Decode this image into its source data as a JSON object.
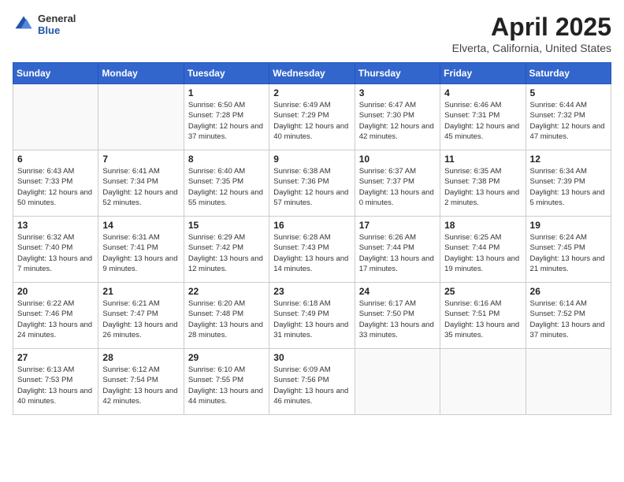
{
  "header": {
    "logo_general": "General",
    "logo_blue": "Blue",
    "title": "April 2025",
    "location": "Elverta, California, United States"
  },
  "weekdays": [
    "Sunday",
    "Monday",
    "Tuesday",
    "Wednesday",
    "Thursday",
    "Friday",
    "Saturday"
  ],
  "weeks": [
    [
      {
        "day": "",
        "info": ""
      },
      {
        "day": "",
        "info": ""
      },
      {
        "day": "1",
        "info": "Sunrise: 6:50 AM\nSunset: 7:28 PM\nDaylight: 12 hours and 37 minutes."
      },
      {
        "day": "2",
        "info": "Sunrise: 6:49 AM\nSunset: 7:29 PM\nDaylight: 12 hours and 40 minutes."
      },
      {
        "day": "3",
        "info": "Sunrise: 6:47 AM\nSunset: 7:30 PM\nDaylight: 12 hours and 42 minutes."
      },
      {
        "day": "4",
        "info": "Sunrise: 6:46 AM\nSunset: 7:31 PM\nDaylight: 12 hours and 45 minutes."
      },
      {
        "day": "5",
        "info": "Sunrise: 6:44 AM\nSunset: 7:32 PM\nDaylight: 12 hours and 47 minutes."
      }
    ],
    [
      {
        "day": "6",
        "info": "Sunrise: 6:43 AM\nSunset: 7:33 PM\nDaylight: 12 hours and 50 minutes."
      },
      {
        "day": "7",
        "info": "Sunrise: 6:41 AM\nSunset: 7:34 PM\nDaylight: 12 hours and 52 minutes."
      },
      {
        "day": "8",
        "info": "Sunrise: 6:40 AM\nSunset: 7:35 PM\nDaylight: 12 hours and 55 minutes."
      },
      {
        "day": "9",
        "info": "Sunrise: 6:38 AM\nSunset: 7:36 PM\nDaylight: 12 hours and 57 minutes."
      },
      {
        "day": "10",
        "info": "Sunrise: 6:37 AM\nSunset: 7:37 PM\nDaylight: 13 hours and 0 minutes."
      },
      {
        "day": "11",
        "info": "Sunrise: 6:35 AM\nSunset: 7:38 PM\nDaylight: 13 hours and 2 minutes."
      },
      {
        "day": "12",
        "info": "Sunrise: 6:34 AM\nSunset: 7:39 PM\nDaylight: 13 hours and 5 minutes."
      }
    ],
    [
      {
        "day": "13",
        "info": "Sunrise: 6:32 AM\nSunset: 7:40 PM\nDaylight: 13 hours and 7 minutes."
      },
      {
        "day": "14",
        "info": "Sunrise: 6:31 AM\nSunset: 7:41 PM\nDaylight: 13 hours and 9 minutes."
      },
      {
        "day": "15",
        "info": "Sunrise: 6:29 AM\nSunset: 7:42 PM\nDaylight: 13 hours and 12 minutes."
      },
      {
        "day": "16",
        "info": "Sunrise: 6:28 AM\nSunset: 7:43 PM\nDaylight: 13 hours and 14 minutes."
      },
      {
        "day": "17",
        "info": "Sunrise: 6:26 AM\nSunset: 7:44 PM\nDaylight: 13 hours and 17 minutes."
      },
      {
        "day": "18",
        "info": "Sunrise: 6:25 AM\nSunset: 7:44 PM\nDaylight: 13 hours and 19 minutes."
      },
      {
        "day": "19",
        "info": "Sunrise: 6:24 AM\nSunset: 7:45 PM\nDaylight: 13 hours and 21 minutes."
      }
    ],
    [
      {
        "day": "20",
        "info": "Sunrise: 6:22 AM\nSunset: 7:46 PM\nDaylight: 13 hours and 24 minutes."
      },
      {
        "day": "21",
        "info": "Sunrise: 6:21 AM\nSunset: 7:47 PM\nDaylight: 13 hours and 26 minutes."
      },
      {
        "day": "22",
        "info": "Sunrise: 6:20 AM\nSunset: 7:48 PM\nDaylight: 13 hours and 28 minutes."
      },
      {
        "day": "23",
        "info": "Sunrise: 6:18 AM\nSunset: 7:49 PM\nDaylight: 13 hours and 31 minutes."
      },
      {
        "day": "24",
        "info": "Sunrise: 6:17 AM\nSunset: 7:50 PM\nDaylight: 13 hours and 33 minutes."
      },
      {
        "day": "25",
        "info": "Sunrise: 6:16 AM\nSunset: 7:51 PM\nDaylight: 13 hours and 35 minutes."
      },
      {
        "day": "26",
        "info": "Sunrise: 6:14 AM\nSunset: 7:52 PM\nDaylight: 13 hours and 37 minutes."
      }
    ],
    [
      {
        "day": "27",
        "info": "Sunrise: 6:13 AM\nSunset: 7:53 PM\nDaylight: 13 hours and 40 minutes."
      },
      {
        "day": "28",
        "info": "Sunrise: 6:12 AM\nSunset: 7:54 PM\nDaylight: 13 hours and 42 minutes."
      },
      {
        "day": "29",
        "info": "Sunrise: 6:10 AM\nSunset: 7:55 PM\nDaylight: 13 hours and 44 minutes."
      },
      {
        "day": "30",
        "info": "Sunrise: 6:09 AM\nSunset: 7:56 PM\nDaylight: 13 hours and 46 minutes."
      },
      {
        "day": "",
        "info": ""
      },
      {
        "day": "",
        "info": ""
      },
      {
        "day": "",
        "info": ""
      }
    ]
  ]
}
